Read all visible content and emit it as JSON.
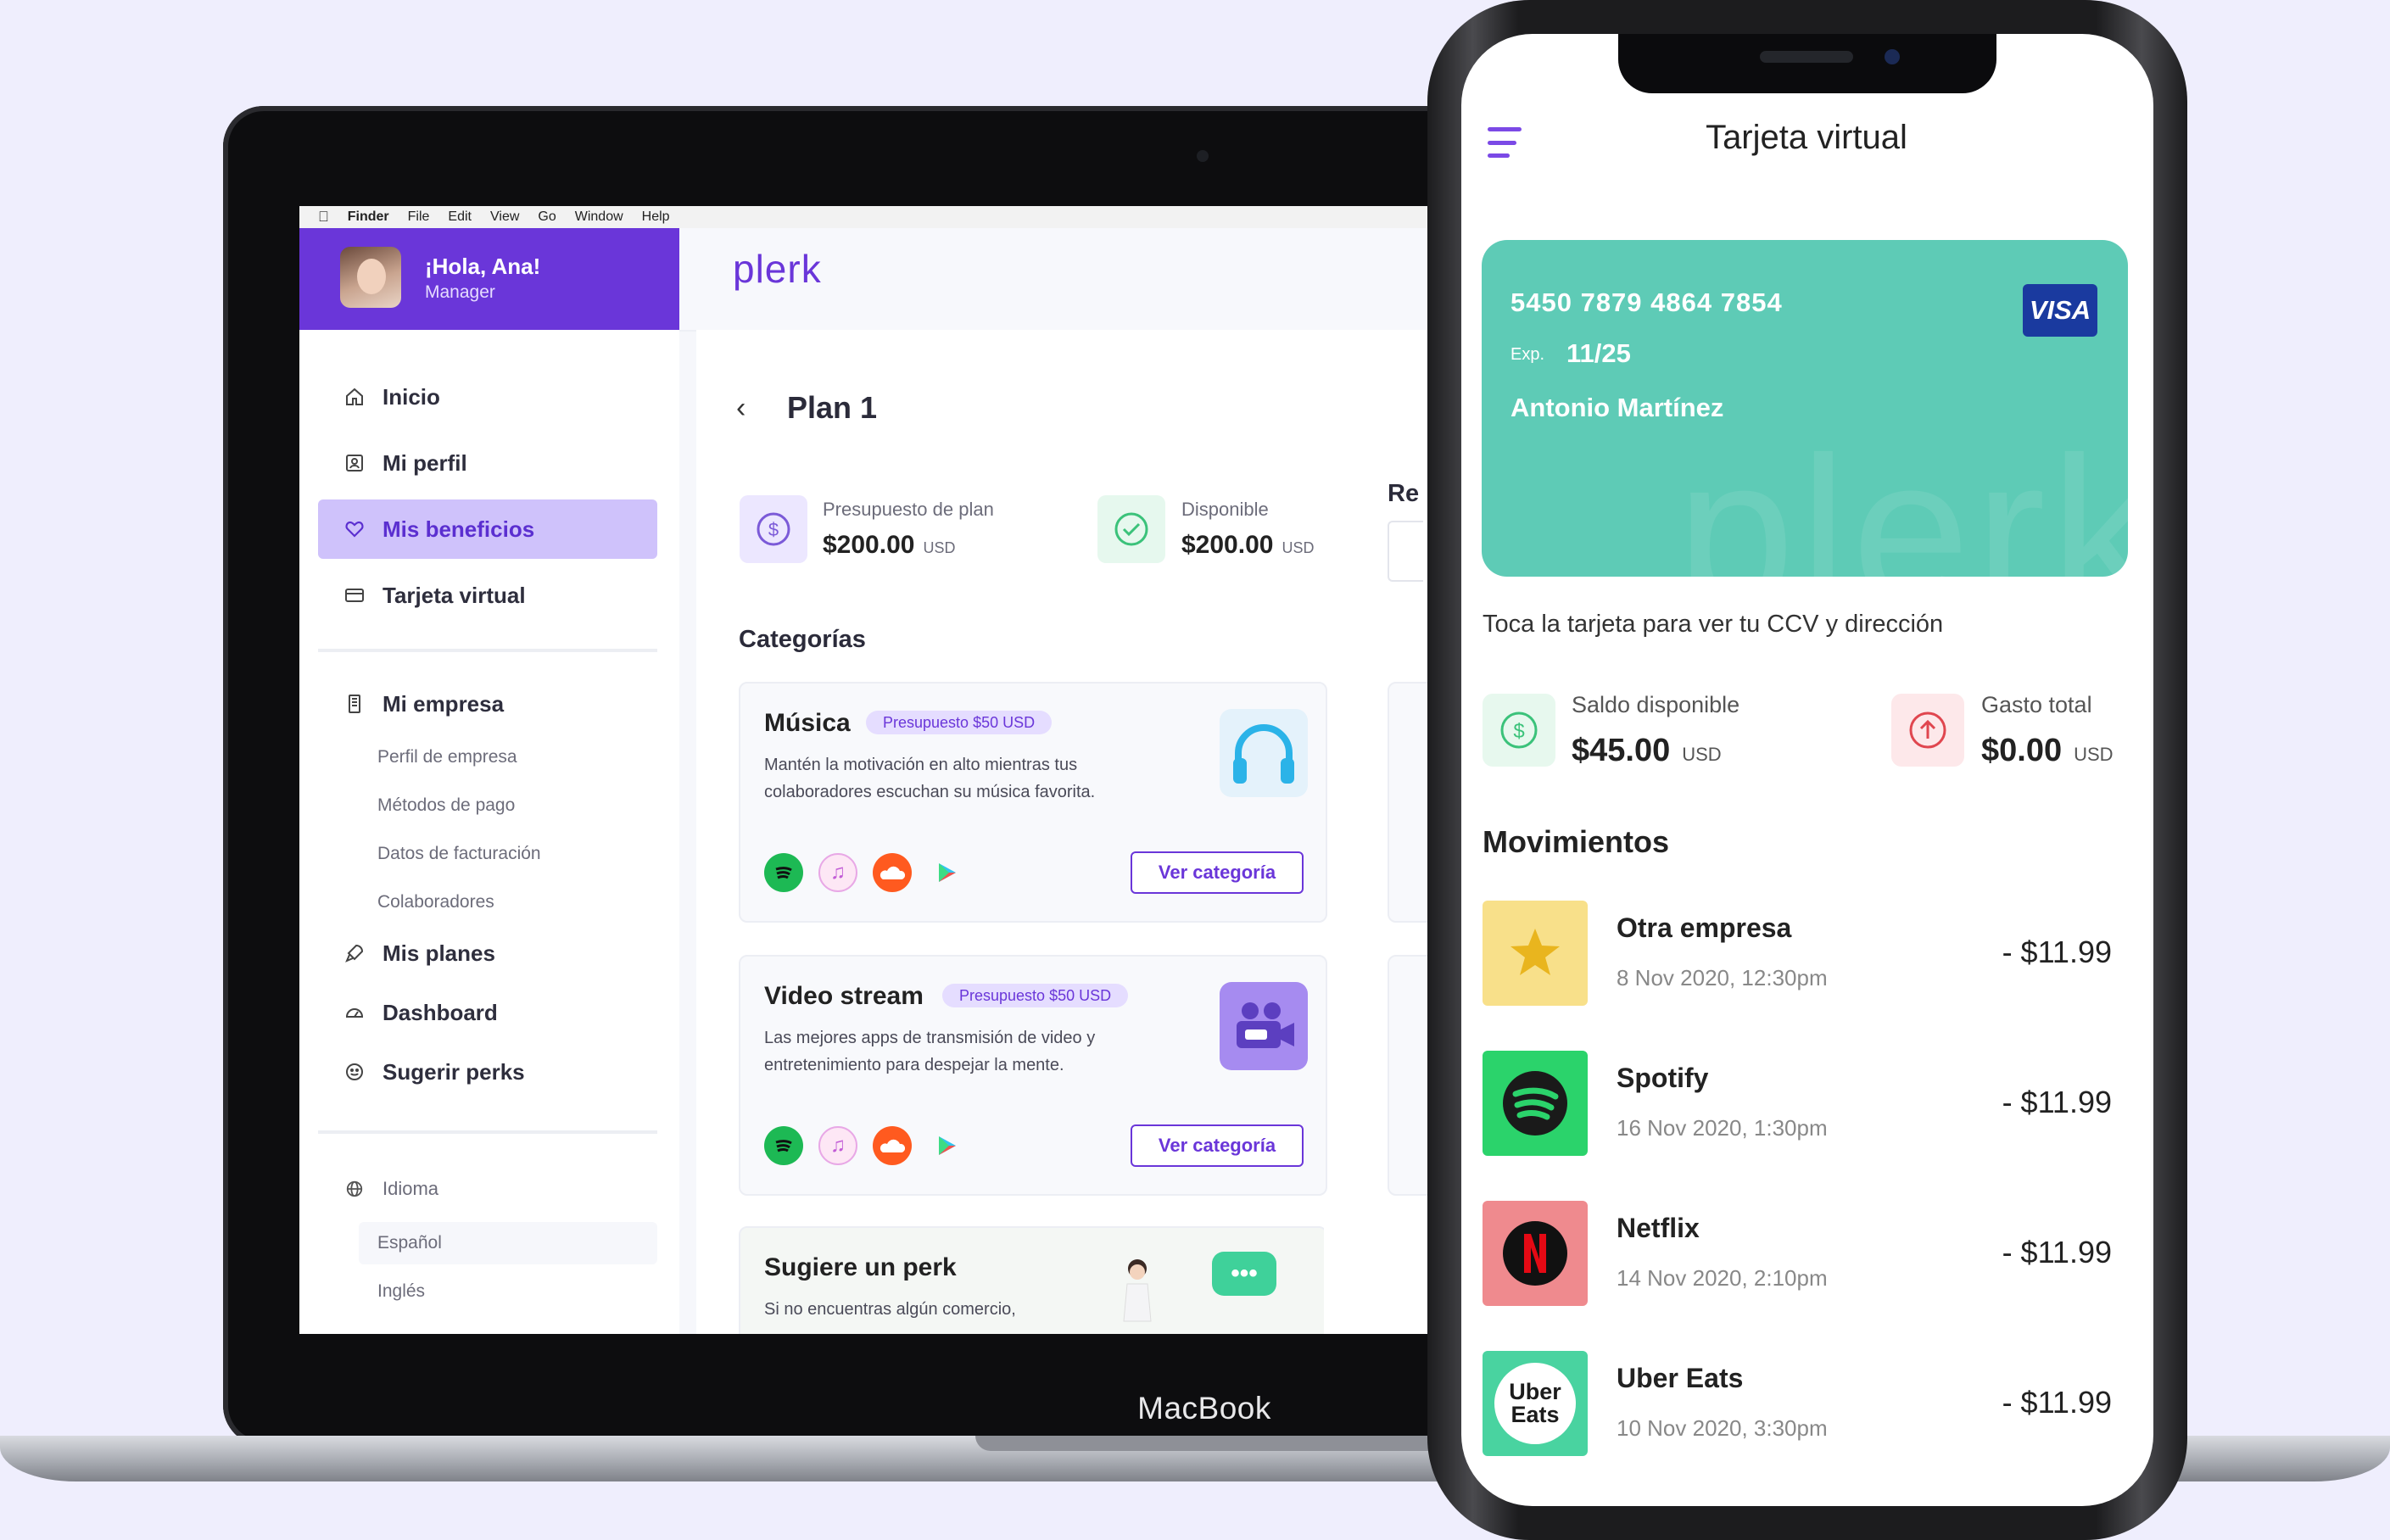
{
  "device_label": "MacBook",
  "menubar": {
    "items": [
      "Finder",
      "File",
      "Edit",
      "View",
      "Go",
      "Window",
      "Help"
    ]
  },
  "sidebar": {
    "greeting": "¡Hola, Ana!",
    "role": "Manager",
    "items": [
      {
        "label": "Inicio",
        "icon": "home-icon"
      },
      {
        "label": "Mi perfil",
        "icon": "profile-icon"
      },
      {
        "label": "Mis beneficios",
        "icon": "heart-icon",
        "active": true
      },
      {
        "label": "Tarjeta virtual",
        "icon": "card-icon"
      }
    ],
    "company": {
      "label": "Mi empresa",
      "icon": "building-icon",
      "sub_items": [
        "Perfil de empresa",
        "Métodos de pago",
        "Datos de facturación",
        "Colaboradores"
      ]
    },
    "items2": [
      {
        "label": "Mis planes",
        "icon": "rocket-icon"
      },
      {
        "label": "Dashboard",
        "icon": "dashboard-icon"
      },
      {
        "label": "Sugerir perks",
        "icon": "smile-icon"
      }
    ],
    "language": {
      "label": "Idioma",
      "icon": "globe-icon",
      "options": [
        "Español",
        "Inglés"
      ]
    }
  },
  "app": {
    "logo": "plerk",
    "plan_title": "Plan 1",
    "stats": [
      {
        "label": "Presupuesto de plan",
        "value": "$200.00",
        "unit": "USD",
        "icon": "dollar-icon"
      },
      {
        "label": "Disponible",
        "value": "$200.00",
        "unit": "USD",
        "icon": "check-circle-icon"
      }
    ],
    "peek_label": "Re",
    "categories_title": "Categorías",
    "categories": [
      {
        "title": "Música",
        "badge": "Presupuesto $50 USD",
        "description": "Mantén la motivación en alto mientras tus colaboradores escuchan su música favorita.",
        "art": "headphones-icon",
        "button": "Ver categoría"
      },
      {
        "title": "Video stream",
        "badge": "Presupuesto $50 USD",
        "description": "Las mejores apps de transmisión de video y entretenimiento para despejar la mente.",
        "art": "video-camera-icon",
        "button": "Ver categoría"
      }
    ],
    "suggest": {
      "title": "Sugiere un perk",
      "description": "Si no encuentras algún comercio,"
    },
    "app_icons": [
      "spotify-icon",
      "itunes-icon",
      "soundcloud-icon",
      "google-play-icon"
    ],
    "colors": {
      "brand": "#6a36d9",
      "brand_light": "#cfc2fb",
      "card": "#5ecbb6"
    }
  },
  "phone": {
    "title": "Tarjeta virtual",
    "card": {
      "number": "5450 7879 4864 7854",
      "exp_label": "Exp.",
      "exp": "11/25",
      "holder": "Antonio Martínez",
      "brand": "VISA",
      "watermark": "plerk"
    },
    "hint": "Toca la tarjeta para ver tu CCV y dirección",
    "balance": {
      "label": "Saldo disponible",
      "value": "$45.00",
      "unit": "USD",
      "icon": "dollar-icon"
    },
    "spent": {
      "label": "Gasto total",
      "value": "$0.00",
      "unit": "USD",
      "icon": "arrow-up-circle-icon"
    },
    "movements_title": "Movimientos",
    "movements": [
      {
        "name": "Otra empresa",
        "date": "8 Nov 2020, 12:30pm",
        "amount": "- $11.99",
        "icon": "star-icon",
        "color": "#f7e08a"
      },
      {
        "name": "Spotify",
        "date": "16 Nov 2020, 1:30pm",
        "amount": "- $11.99",
        "icon": "spotify-icon",
        "color": "#2bd36b"
      },
      {
        "name": "Netflix",
        "date": "14 Nov 2020, 2:10pm",
        "amount": "- $11.99",
        "icon": "netflix-icon",
        "color": "#ef8a8e"
      },
      {
        "name": "Uber Eats",
        "date": "10 Nov 2020, 3:30pm",
        "amount": "- $11.99",
        "icon": "uber-eats-icon",
        "color": "#49d3a0",
        "logo_text": "Uber Eats"
      }
    ]
  }
}
